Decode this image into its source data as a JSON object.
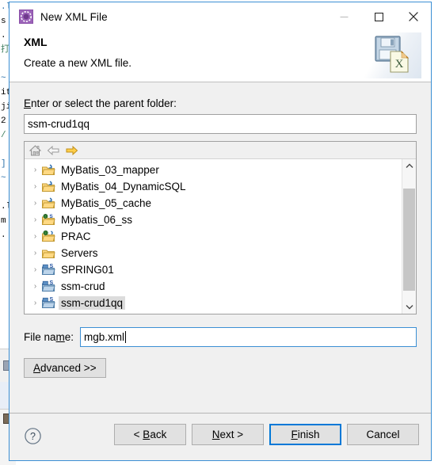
{
  "window": {
    "title": "New XML File",
    "icon": "xml-wizard-icon",
    "controls": {
      "minimize": "minimize-icon",
      "maximize": "maximize-icon",
      "close": "close-icon"
    }
  },
  "header": {
    "title": "XML",
    "subtitle": "Create a new XML file.",
    "banner_icon": "xml-file-save-icon"
  },
  "parent_folder": {
    "label_pre": "",
    "label_mnemonic": "E",
    "label_post": "nter or select the parent folder:",
    "value": "ssm-crud1qq"
  },
  "tree_toolbar": {
    "home": "home-icon",
    "back": "back-arrow-icon",
    "forward": "forward-arrow-icon"
  },
  "tree": {
    "items": [
      {
        "label": "MyBatis_03_mapper",
        "icon": "java-project-folder-icon",
        "expander": "›",
        "selected": false
      },
      {
        "label": "MyBatis_04_DynamicSQL",
        "icon": "java-project-folder-icon",
        "expander": "›",
        "selected": false
      },
      {
        "label": "MyBatis_05_cache",
        "icon": "java-project-folder-icon",
        "expander": "›",
        "selected": false
      },
      {
        "label": "Mybatis_06_ss",
        "icon": "web-project-folder-icon",
        "expander": "›",
        "selected": false
      },
      {
        "label": "PRAC",
        "icon": "dynamic-web-project-folder-icon",
        "expander": "›",
        "selected": false
      },
      {
        "label": "Servers",
        "icon": "plain-folder-icon",
        "expander": "›",
        "selected": false
      },
      {
        "label": "SPRING01",
        "icon": "spring-project-folder-icon",
        "expander": "›",
        "selected": false
      },
      {
        "label": "ssm-crud",
        "icon": "spring-project-folder-icon",
        "expander": "›",
        "selected": false
      },
      {
        "label": "ssm-crud1qq",
        "icon": "spring-project-folder-icon",
        "expander": "›",
        "selected": true
      }
    ]
  },
  "file_name": {
    "label_pre": "File na",
    "label_mnemonic": "m",
    "label_post": "e:",
    "value": "mgb.xml"
  },
  "advanced": {
    "label_pre": "",
    "label_mnemonic": "A",
    "label_post": "dvanced >>"
  },
  "footer": {
    "help": "help-icon",
    "buttons": [
      {
        "name": "back-button",
        "pre": "< ",
        "mnemonic": "B",
        "post": "ack",
        "default": false,
        "enabled": true
      },
      {
        "name": "next-button",
        "pre": "",
        "mnemonic": "N",
        "post": "ext >",
        "default": false,
        "enabled": true
      },
      {
        "name": "finish-button",
        "pre": "",
        "mnemonic": "F",
        "post": "inish",
        "default": true,
        "enabled": true
      },
      {
        "name": "cancel-button",
        "pre": "",
        "mnemonic": "",
        "post": "Cancel",
        "default": false,
        "enabled": true
      }
    ]
  },
  "backdrop": {
    "code_lines": [
      ".l",
      "s",
      ".",
      "打",
      "",
      "~",
      "it",
      "ji",
      "2",
      "/",
      "",
      "]",
      "~",
      "",
      ".l",
      "m",
      ".",
      "",
      "",
      "",
      "",
      ""
    ]
  },
  "colors": {
    "dialog_border": "#3b8fd4",
    "accent": "#0078d7",
    "selection": "#dcdcdc",
    "body_bg": "#f0f0f0",
    "field_bg": "#ffffff"
  }
}
